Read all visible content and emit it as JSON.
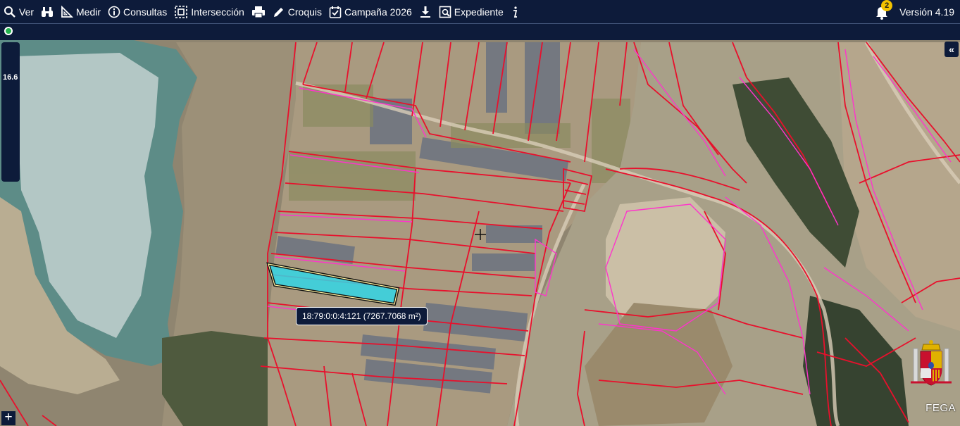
{
  "toolbar": {
    "items": [
      {
        "label": "Ver",
        "icon": "search-icon"
      },
      {
        "label": "",
        "icon": "binoculars-icon"
      },
      {
        "label": "Medir",
        "icon": "ruler-icon"
      },
      {
        "label": "Consultas",
        "icon": "info-circle-icon"
      },
      {
        "label": "Intersección",
        "icon": "intersection-icon"
      },
      {
        "label": "",
        "icon": "print-icon"
      },
      {
        "label": "Croquis",
        "icon": "pencil-icon"
      },
      {
        "label": "Campaña 2026",
        "icon": "calendar-check-icon"
      },
      {
        "label": "",
        "icon": "download-icon"
      },
      {
        "label": "Expediente",
        "icon": "file-search-icon"
      },
      {
        "label": "",
        "icon": "info-icon"
      }
    ],
    "notifications": "2",
    "version": "Versión 4.19"
  },
  "map": {
    "zoom_level": "16.6",
    "selected_parcel_label": "18:79:0:0:4:121 (7267.7068 m²)",
    "attribution": "FEGA",
    "colors": {
      "parcel_border": "#e8102c",
      "enclosure_border": "#ff33cc",
      "selected_fill": "#33d6e6",
      "water": "#5f8f8a",
      "toolbar": "#0d1b3a"
    }
  }
}
